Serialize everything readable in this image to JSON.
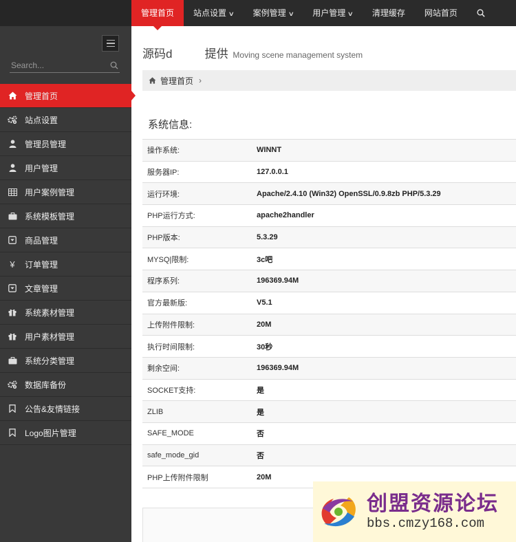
{
  "topnav": {
    "items": [
      {
        "label": "管理首页",
        "active": true
      },
      {
        "label": "站点设置",
        "dropdown": true
      },
      {
        "label": "案例管理",
        "dropdown": true
      },
      {
        "label": "用户管理",
        "dropdown": true
      },
      {
        "label": "清理缓存"
      },
      {
        "label": "网站首页"
      }
    ],
    "search_icon": "search-icon"
  },
  "sidebar": {
    "search_placeholder": "Search...",
    "items": [
      {
        "label": "管理首页",
        "icon": "home-icon",
        "active": true
      },
      {
        "label": "站点设置",
        "icon": "cogs-icon"
      },
      {
        "label": "管理员管理",
        "icon": "user-icon"
      },
      {
        "label": "用户管理",
        "icon": "user-icon"
      },
      {
        "label": "用户案例管理",
        "icon": "table-icon"
      },
      {
        "label": "系统模板管理",
        "icon": "briefcase-icon"
      },
      {
        "label": "商品管理",
        "icon": "caret-square-icon"
      },
      {
        "label": "订单管理",
        "icon": "yen-icon"
      },
      {
        "label": "文章管理",
        "icon": "caret-square-icon"
      },
      {
        "label": "系统素材管理",
        "icon": "gift-icon"
      },
      {
        "label": "用户素材管理",
        "icon": "gift-icon"
      },
      {
        "label": "系统分类管理",
        "icon": "briefcase-icon"
      },
      {
        "label": "数据库备份",
        "icon": "cogs-icon"
      },
      {
        "label": "公告&友情链接",
        "icon": "bookmark-icon"
      },
      {
        "label": "Logo图片管理",
        "icon": "bookmark-icon"
      }
    ]
  },
  "page": {
    "title": "源码d          提供",
    "subtitle": "Moving scene management system"
  },
  "breadcrumb": {
    "label": "管理首页"
  },
  "system_info": {
    "title": "系统信息:",
    "rows": [
      {
        "key": "操作系统:",
        "value": "WINNT"
      },
      {
        "key": "服务器IP:",
        "value": "127.0.0.1"
      },
      {
        "key": "运行环境:",
        "value": "Apache/2.4.10 (Win32) OpenSSL/0.9.8zb PHP/5.3.29"
      },
      {
        "key": "PHP运行方式:",
        "value": "apache2handler"
      },
      {
        "key": "PHP版本:",
        "value": "5.3.29"
      },
      {
        "key": "MYSQ|限制:",
        "value": "3c吧"
      },
      {
        "key": "程序系列:",
        "value": "196369.94M"
      },
      {
        "key": "官方最新版:",
        "value": "V5.1"
      },
      {
        "key": "上传附件限制:",
        "value": "20M"
      },
      {
        "key": "执行时间限制:",
        "value": "30秒"
      },
      {
        "key": "剩余空间:",
        "value": "196369.94M"
      },
      {
        "key": "SOCKET支持:",
        "value": "是"
      },
      {
        "key": "ZLIB",
        "value": "是"
      },
      {
        "key": "SAFE_MODE",
        "value": "否"
      },
      {
        "key": "safe_mode_gid",
        "value": "否"
      },
      {
        "key": "PHP上传附件限制",
        "value": "20M"
      }
    ]
  },
  "watermark": {
    "brand": "创盟资源论坛",
    "url": "bbs.cmzy168.com"
  },
  "colors": {
    "accent": "#e02424",
    "sidebar": "#393939",
    "topbar": "#2b2b2b"
  }
}
